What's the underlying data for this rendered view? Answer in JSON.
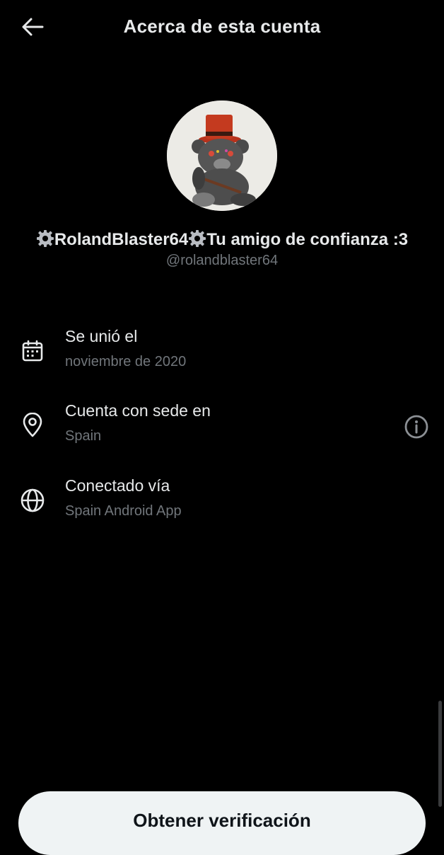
{
  "header": {
    "title": "Acerca de esta cuenta",
    "back_icon": "arrow-left-icon"
  },
  "profile": {
    "display_name_part1": "RolandBlaster64",
    "display_name_part2": "Tu amigo de confianza :3",
    "emoji_icon": "gear-emoji-icon",
    "handle": "@rolandblaster64"
  },
  "details": [
    {
      "icon": "calendar-icon",
      "label": "Se unió el",
      "value": "noviembre de 2020"
    },
    {
      "icon": "location-pin-icon",
      "label": "Cuenta con sede en",
      "value": "Spain",
      "action_icon": "info-icon"
    },
    {
      "icon": "globe-icon",
      "label": "Conectado vía",
      "value": "Spain Android App"
    }
  ],
  "footer": {
    "button_label": "Obtener verificación"
  },
  "colors": {
    "background": "#000000",
    "primary_text": "#e7e9ea",
    "secondary_text": "#71767b",
    "button_bg": "#eff3f4",
    "button_text": "#0f1419"
  }
}
